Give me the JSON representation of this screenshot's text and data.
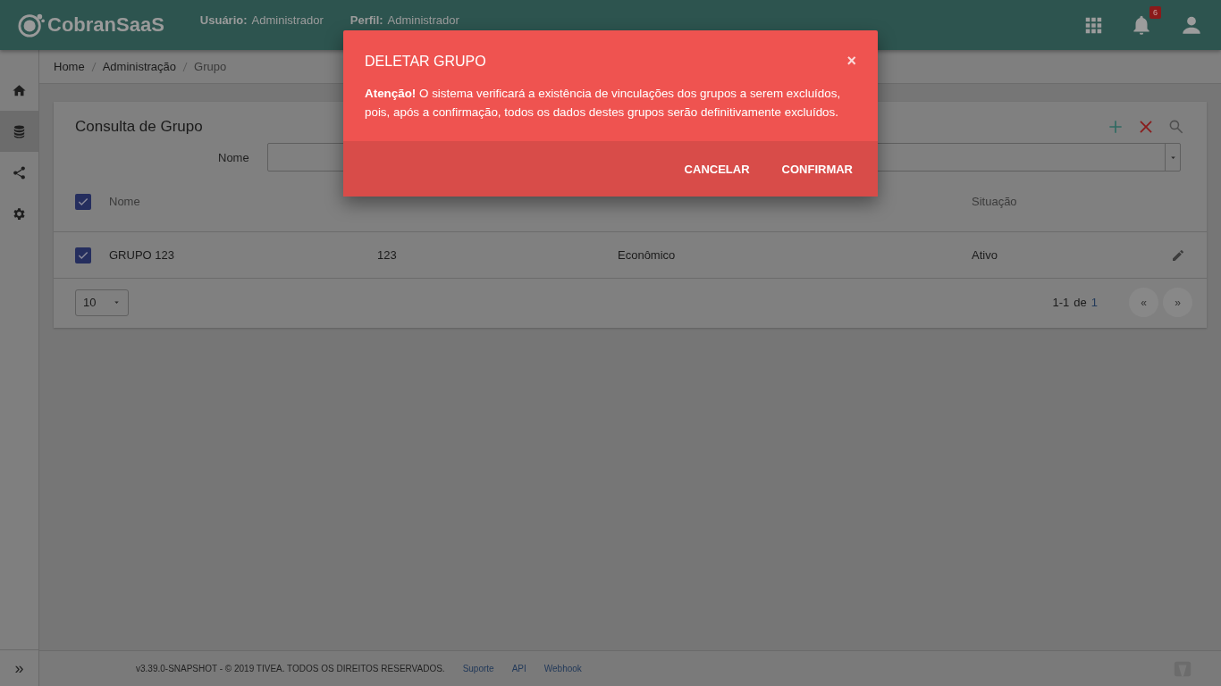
{
  "header": {
    "logo": "CobranSaaS",
    "user_label": "Usuário:",
    "user": "Administrador",
    "profile_label": "Perfil:",
    "profile": "Administrador",
    "notifications": "6"
  },
  "sidebar": {
    "items": [
      {
        "kind": "home",
        "selected": false
      },
      {
        "kind": "database",
        "selected": true
      },
      {
        "kind": "share",
        "selected": false
      },
      {
        "kind": "gear",
        "selected": false
      }
    ],
    "expand": "»"
  },
  "breadcrumb": [
    "Home",
    "Administração",
    "Grupo"
  ],
  "card": {
    "title": "Consulta de Grupo",
    "filter_label": "Nome",
    "columns": [
      "Nome",
      "",
      "",
      "Situação"
    ],
    "header_checked": true,
    "rows": [
      {
        "checked": true,
        "cells": [
          "GRUPO 123",
          "123",
          "Econômico",
          "Ativo"
        ]
      }
    ],
    "page_size": "10",
    "range": "1-1",
    "of": "de",
    "total": "1",
    "prev": "«",
    "next": "»"
  },
  "footer": {
    "copyright": "v3.39.0-SNAPSHOT - © 2019 TIVEA. TODOS OS DIREITOS RESERVADOS.",
    "links": [
      "Suporte",
      "API",
      "Webhook"
    ]
  },
  "dialog": {
    "title": "DELETAR GRUPO",
    "close": "×",
    "message": "**Atenção!** O sistema verificará a existência de vinculações dos grupos a serem excluídos, pois, após a confirmação, todos os dados destes grupos serão definitivamente excluídos.",
    "buttons": [
      "CANCELAR",
      "CONFIRMAR"
    ]
  }
}
